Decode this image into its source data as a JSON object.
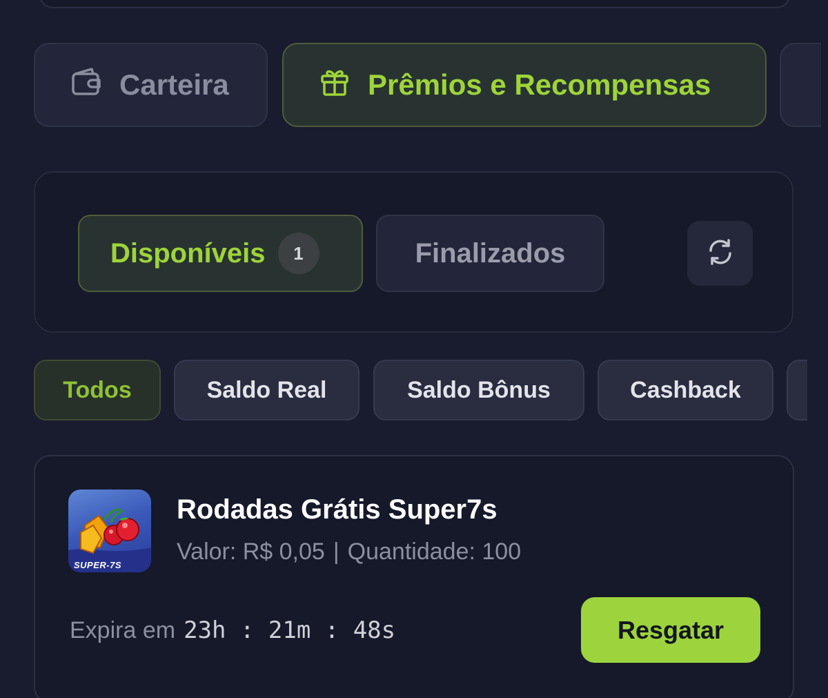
{
  "main_tabs": {
    "wallet_label": "Carteira",
    "rewards_label": "Prêmios e Recompensas"
  },
  "status_tabs": {
    "available_label": "Disponíveis",
    "available_count": "1",
    "finished_label": "Finalizados"
  },
  "filters": {
    "all": "Todos",
    "real_balance": "Saldo Real",
    "bonus_balance": "Saldo Bônus",
    "cashback": "Cashback"
  },
  "reward": {
    "title": "Rodadas Grátis Super7s",
    "value_text": "Valor: R$ 0,05",
    "quantity_text": "Quantidade: 100",
    "separator": "|",
    "thumb_label": "SUPER-7S",
    "expiry_label": "Expira em",
    "timer": "23h : 21m : 48s",
    "redeem_label": "Resgatar"
  },
  "colors": {
    "accent": "#9ed43a",
    "background": "#191c2e",
    "button_accent": "#9dd43d"
  },
  "icons": {
    "wallet": "wallet-icon",
    "gift": "gift-icon",
    "refresh": "refresh-icon"
  }
}
